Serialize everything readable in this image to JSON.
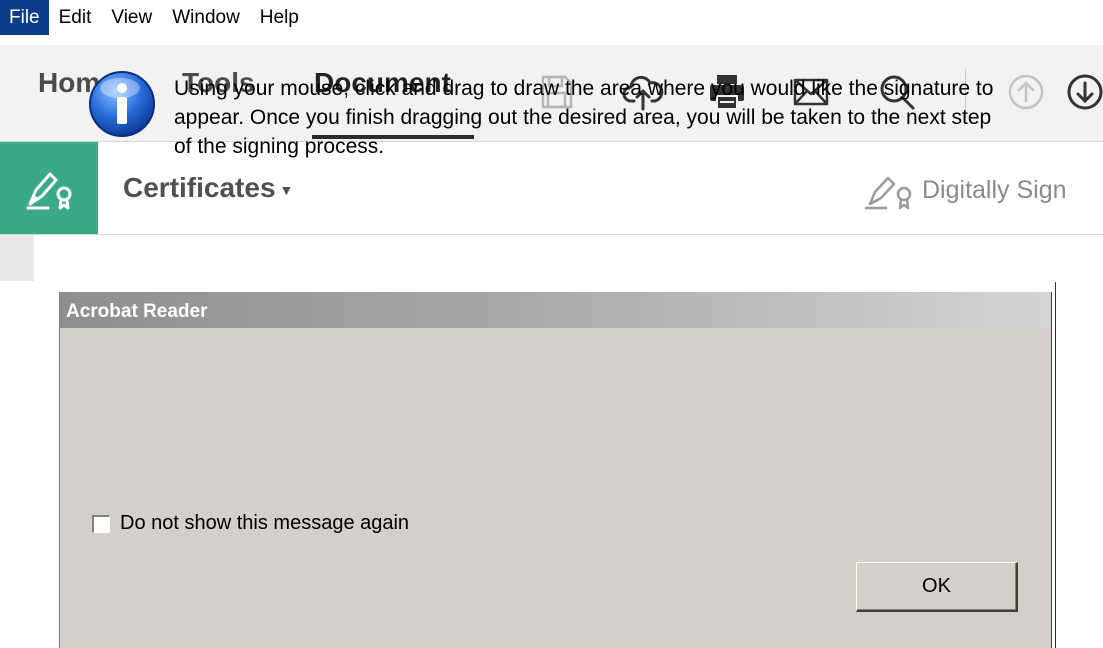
{
  "menubar": {
    "items": [
      "File",
      "Edit",
      "View",
      "Window",
      "Help"
    ]
  },
  "tabs": {
    "home": "Home",
    "tools": "Tools",
    "document": "Document"
  },
  "toolbar": {
    "icons": [
      "save-icon",
      "upload-cloud-icon",
      "print-icon",
      "email-icon",
      "search-icon",
      "page-up-icon",
      "page-down-icon"
    ]
  },
  "certificates": {
    "title": "Certificates",
    "digitally_sign": "Digitally Sign"
  },
  "dialog": {
    "title": "Acrobat Reader",
    "message": "Using your mouse, click and drag to draw the area where you would like the signature to appear. Once you finish dragging out the desired area, you will be taken to the next step of the signing process.",
    "checkbox_label": "Do not show this message again",
    "checkbox_checked": false,
    "ok_label": "OK"
  },
  "colors": {
    "menu_active_bg": "#0b3e8a",
    "cert_badge_bg": "#3aa98a",
    "dialog_bg": "#d4d0c8"
  }
}
